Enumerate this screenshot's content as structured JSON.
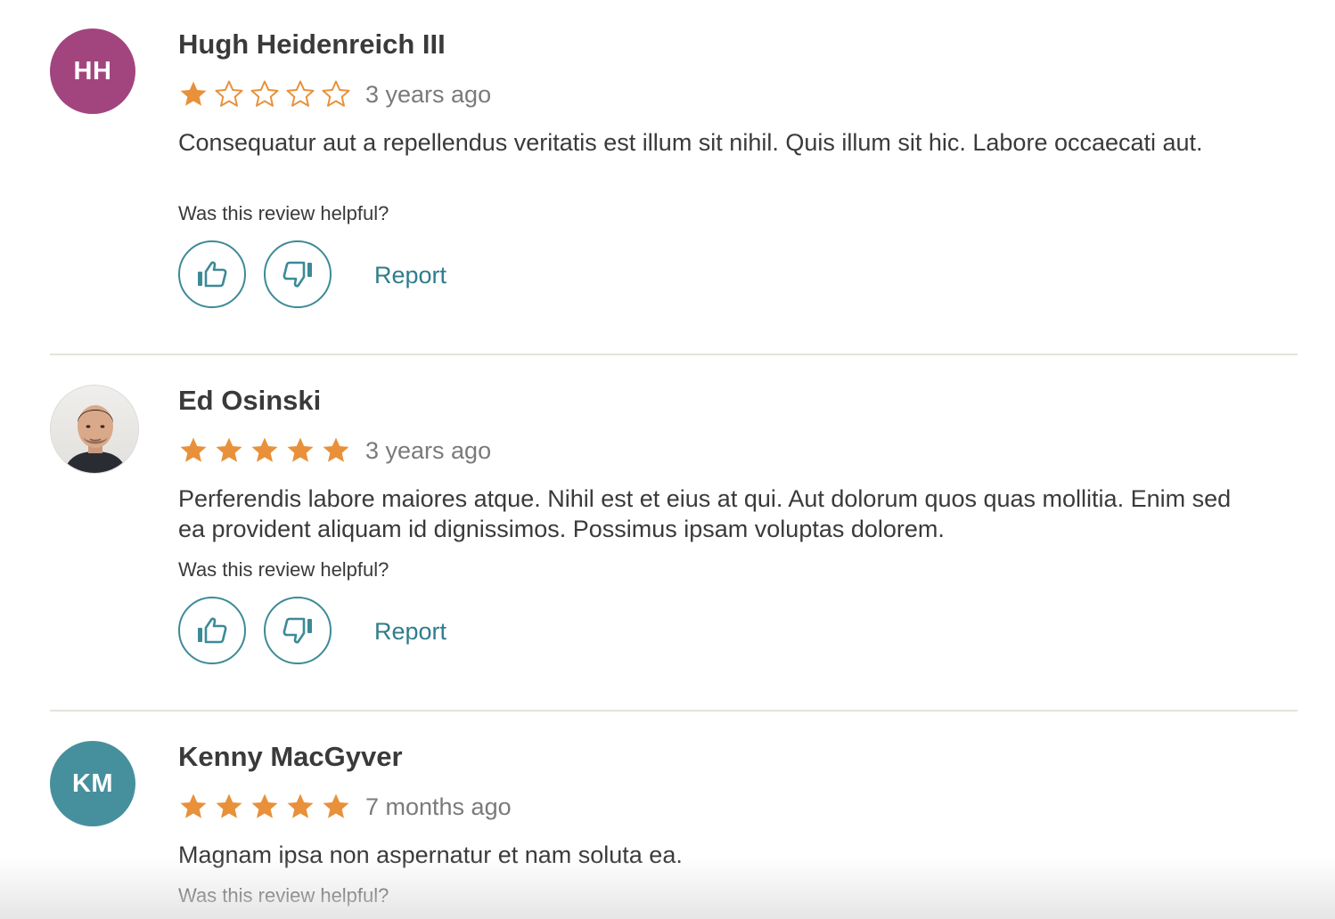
{
  "colors": {
    "star": "#e8913a",
    "accent": "#3d8a97",
    "divider": "#e4e2dc"
  },
  "helpful_prompt": "Was this review helpful?",
  "report_label": "Report",
  "reviews": [
    {
      "initials": "HH",
      "avatar_color": "#a2457f",
      "name": "Hugh Heidenreich III",
      "rating": 1,
      "max_rating": 5,
      "date": "3 years ago",
      "body": "Consequatur aut a repellendus veritatis est illum sit nihil. Quis illum sit hic. Labore occaecati aut."
    },
    {
      "initials": "",
      "avatar_color": "",
      "name": "Ed Osinski",
      "rating": 5,
      "max_rating": 5,
      "date": "3 years ago",
      "body": "Perferendis labore maiores atque. Nihil est et eius at qui. Aut dolorum quos quas mollitia. Enim sed ea provident aliquam id dignissimos. Possimus ipsam voluptas dolorem."
    },
    {
      "initials": "KM",
      "avatar_color": "#46909e",
      "name": "Kenny MacGyver",
      "rating": 5,
      "max_rating": 5,
      "date": "7 months ago",
      "body": "Magnam ipsa non aspernatur et nam soluta ea."
    }
  ]
}
